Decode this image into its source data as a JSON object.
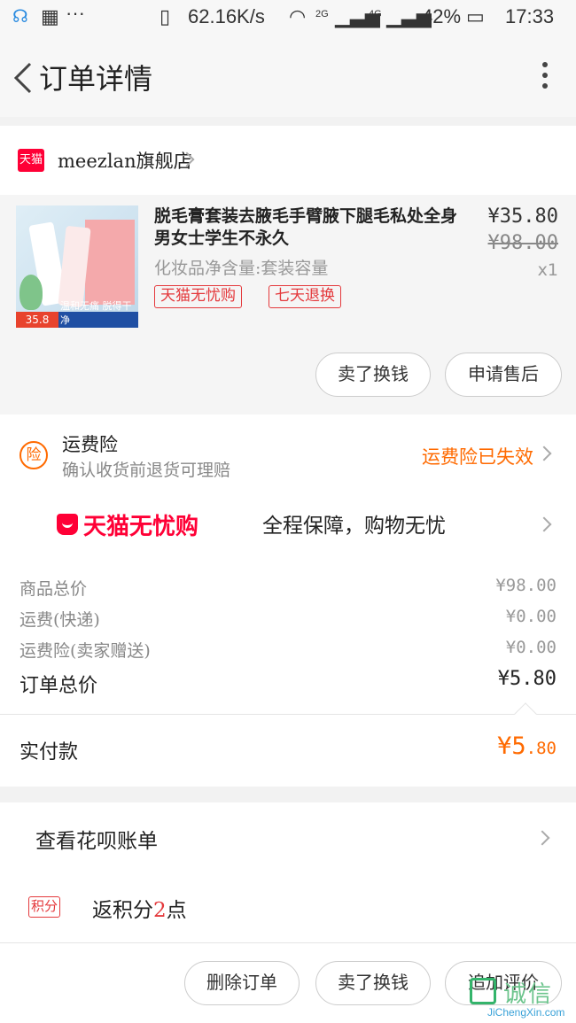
{
  "status_bar": {
    "net_speed": "62.16K/s",
    "net_2g": "2G",
    "net_4g": "4G",
    "battery": "42%",
    "time": "17:33"
  },
  "nav": {
    "title": "订单详情"
  },
  "shop": {
    "name": "meezlan旗舰店",
    "badge": "天猫"
  },
  "product": {
    "title": "脱毛膏套装去腋毛手臂腋下腿毛私处全身男女士学生不永久",
    "spec": "化妆品净含量:套装容量",
    "price": "¥35.80",
    "original_price": "¥98.00",
    "quantity": "x1",
    "tags": [
      "天猫无忧购",
      "七天退换"
    ],
    "thumb_price": "35.8",
    "thumb_slogan": "温和无痛 脱得干净"
  },
  "product_actions": {
    "sell": "卖了换钱",
    "after_sale": "申请售后"
  },
  "insurance": {
    "icon": "险",
    "title": "运费险",
    "subtitle": "确认收货前退货可理赔",
    "status": "运费险已失效"
  },
  "guarantee": {
    "logo_text": "天猫无忧购",
    "text": "全程保障，购物无忧"
  },
  "totals": {
    "rows": [
      {
        "label": "商品总价",
        "value": "¥98.00"
      },
      {
        "label": "运费(快递)",
        "value": "¥0.00"
      },
      {
        "label": "运费险(卖家赠送)",
        "value": "¥0.00"
      }
    ],
    "order_total_label": "订单总价",
    "order_total_value": "¥5.80"
  },
  "paid": {
    "label": "实付款",
    "currency": "¥",
    "integer": "5",
    "decimal": ".80"
  },
  "huabei": {
    "label": "查看花呗账单"
  },
  "points": {
    "tag": "积分",
    "prefix": "返积分",
    "count": "2",
    "suffix": "点"
  },
  "bottom_actions": {
    "delete": "删除订单",
    "sell": "卖了换钱",
    "review": "追加评价"
  },
  "watermark": {
    "cn": "诚信",
    "en": "JiChengXin.com"
  },
  "colors": {
    "accent_orange": "#ff6a00",
    "tmall_red": "#ff0036",
    "tag_red": "#e4393c"
  }
}
